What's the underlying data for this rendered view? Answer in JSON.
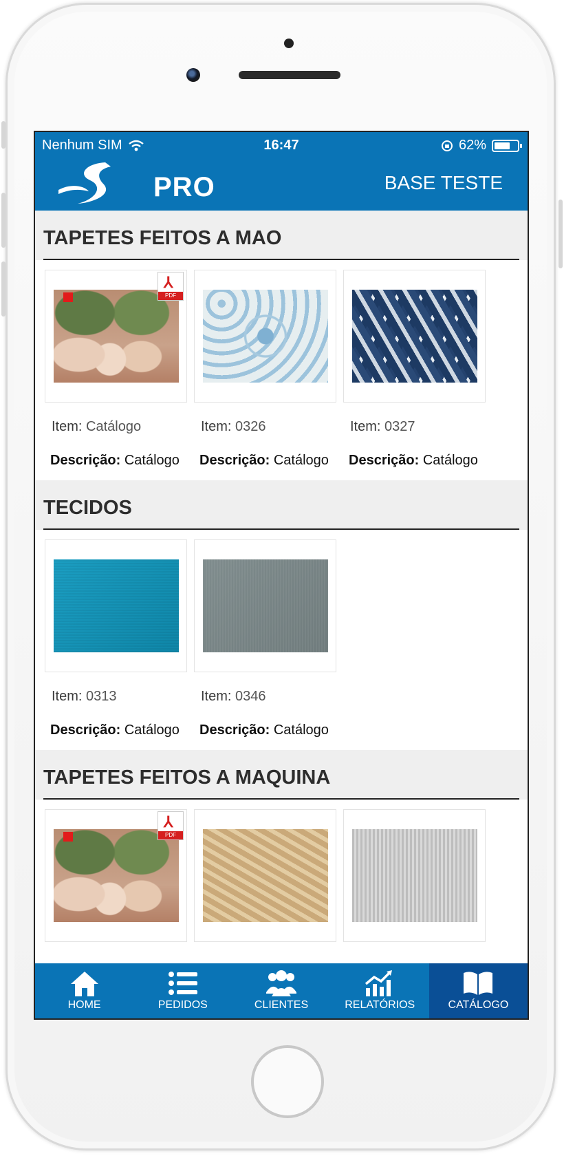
{
  "status_bar": {
    "carrier": "Nenhum SIM",
    "time": "16:47",
    "battery": "62%",
    "battery_level": 0.62
  },
  "header": {
    "logo_text": "PRO",
    "title": "BASE TESTE"
  },
  "labels": {
    "item": "Item:",
    "description": "Descrição:"
  },
  "sections": [
    {
      "title": "TAPETES FEITOS A MAO",
      "items": [
        {
          "code": "Catálogo",
          "desc": "Catálogo",
          "pdf": true
        },
        {
          "code": "0326",
          "desc": "Catálogo"
        },
        {
          "code": "0327",
          "desc": "Catálogo"
        }
      ]
    },
    {
      "title": "TECIDOS",
      "items": [
        {
          "code": "0313",
          "desc": "Catálogo"
        },
        {
          "code": "0346",
          "desc": "Catálogo"
        }
      ]
    },
    {
      "title": "TAPETES FEITOS A MAQUINA",
      "items": [
        {
          "pdf": true
        },
        {},
        {}
      ]
    }
  ],
  "pdf_badge": "PDF",
  "tabs": [
    {
      "label": "HOME",
      "icon": "home-icon"
    },
    {
      "label": "PEDIDOS",
      "icon": "list-icon"
    },
    {
      "label": "CLIENTES",
      "icon": "users-icon"
    },
    {
      "label": "RELATÓRIOS",
      "icon": "chart-icon"
    },
    {
      "label": "CATÁLOGO",
      "icon": "book-icon",
      "active": true
    }
  ],
  "colors": {
    "primary": "#0a74b6",
    "active_tab": "#0a4f96",
    "section_bg": "#efefef"
  }
}
